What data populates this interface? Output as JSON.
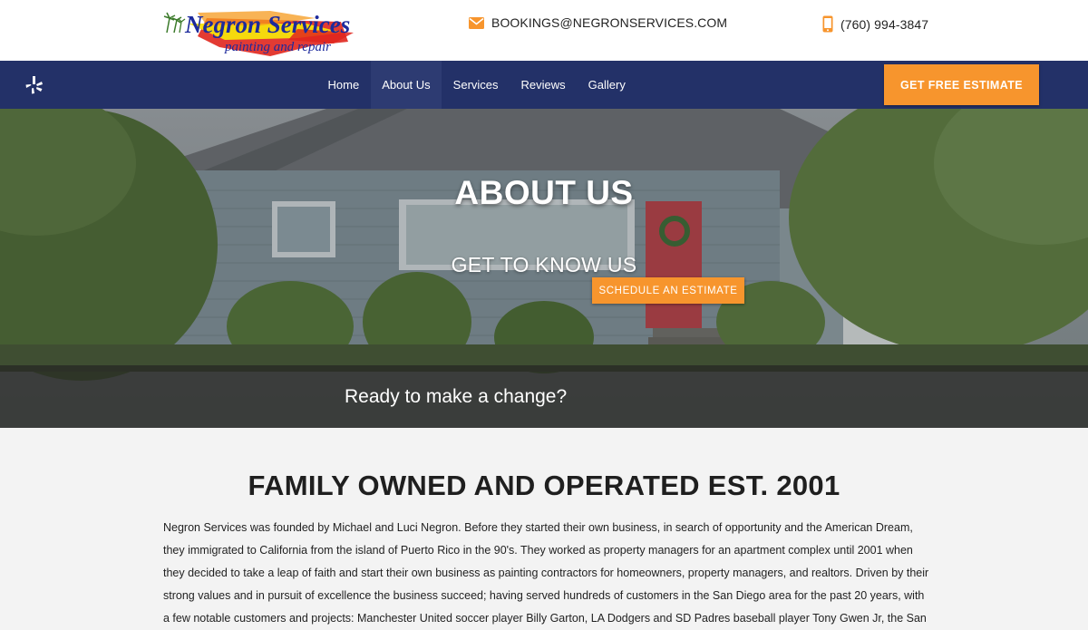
{
  "brand": {
    "logo_name": "Negron Services",
    "logo_tagline": "painting and repair"
  },
  "header": {
    "email": "BOOKINGS@NEGRONSERVICES.COM",
    "phone": "(760) 994-3847"
  },
  "nav": {
    "items": [
      {
        "label": "Home"
      },
      {
        "label": "About Us"
      },
      {
        "label": "Services"
      },
      {
        "label": "Reviews"
      },
      {
        "label": "Gallery"
      }
    ],
    "active": "About Us",
    "cta_label": "GET FREE ESTIMATE"
  },
  "hero": {
    "title": "ABOUT US",
    "subtitle": "GET TO KNOW US",
    "band_text": "Ready to make a change?",
    "band_button": "SCHEDULE AN ESTIMATE"
  },
  "main": {
    "title": "FAMILY OWNED AND OPERATED EST. 2001",
    "paragraph": "Negron Services was founded by Michael and Luci Negron. Before they started their own business, in search of opportunity and the American Dream, they immigrated to California from the island of Puerto Rico in the 90's. They worked as property managers for an apartment complex until 2001 when they decided to take a leap of faith and start their own business as painting contractors for homeowners, property managers, and realtors. Driven by their strong values and in pursuit of excellence the business succeed; having served hundreds of customers in the San Diego area for the past 20 years, with a few notable customers and projects: Manchester United soccer player Billy Garton, LA Dodgers and SD Padres baseball player Tony Gwen Jr, the San"
  },
  "colors": {
    "nav_bg": "#233168",
    "accent_orange": "#f7952d",
    "logo_blue": "#1d2a9c"
  },
  "icons": {
    "email": "envelope-icon",
    "phone": "mobile-phone-icon",
    "social": "yelp-icon"
  }
}
